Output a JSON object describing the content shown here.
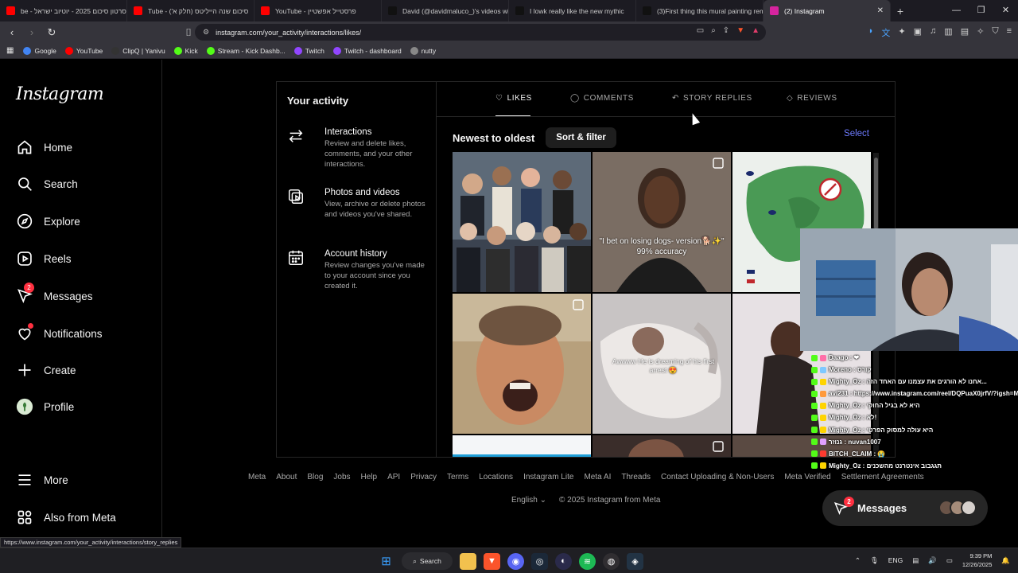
{
  "browser": {
    "tabs": [
      {
        "label": "be - סרטון סיכום 2025 - יוטיוב ישראל",
        "fav_color": "#ff0000"
      },
      {
        "label": "Tube - סיכום שנה הייליטס (חלק א')",
        "fav_color": "#ff0000"
      },
      {
        "label": "YouTube - פרסטייל אפשטיין",
        "fav_color": "#ff0000"
      },
      {
        "label": "David (@davidmaluco_)'s videos with",
        "fav_color": "#111111"
      },
      {
        "label": "I lowk really like the new mythic",
        "fav_color": "#111111"
      },
      {
        "label": "(3)First thing this mural painting rem",
        "fav_color": "#111111"
      },
      {
        "label": "(2) Instagram",
        "fav_color": "#d6249f"
      }
    ],
    "new_tab": "+",
    "url": "instagram.com/your_activity/interactions/likes/",
    "bookmarks": [
      {
        "label": "Google",
        "color": "#4285f4"
      },
      {
        "label": "YouTube",
        "color": "#ff0000"
      },
      {
        "label": "ClipQ | Yanivu",
        "color": "#333333"
      },
      {
        "label": "Kick",
        "color": "#53fc18"
      },
      {
        "label": "Stream - Kick Dashb...",
        "color": "#53fc18"
      },
      {
        "label": "Twitch",
        "color": "#9146ff"
      },
      {
        "label": "Twitch - dashboard",
        "color": "#9146ff"
      },
      {
        "label": "nutty",
        "color": "#888888"
      }
    ],
    "status_url": "https://www.instagram.com/your_activity/interactions/story_replies"
  },
  "instagram": {
    "logo": "Instagram",
    "nav": [
      {
        "label": "Home",
        "icon": "home-icon"
      },
      {
        "label": "Search",
        "icon": "search-icon"
      },
      {
        "label": "Explore",
        "icon": "explore-icon"
      },
      {
        "label": "Reels",
        "icon": "reels-icon"
      },
      {
        "label": "Messages",
        "icon": "messages-icon",
        "badge": "2"
      },
      {
        "label": "Notifications",
        "icon": "heart-icon"
      },
      {
        "label": "Create",
        "icon": "plus-icon"
      },
      {
        "label": "Profile",
        "icon": "avatar"
      }
    ],
    "more": "More",
    "also_from_meta": "Also from Meta",
    "activity": {
      "title": "Your activity",
      "menu": [
        {
          "title": "Interactions",
          "desc": "Review and delete likes, comments, and your other interactions."
        },
        {
          "title": "Photos and videos",
          "desc": "View, archive or delete photos and videos you've shared."
        },
        {
          "title": "Account history",
          "desc": "Review changes you've made to your account since you created it."
        }
      ]
    },
    "tabs": [
      "LIKES",
      "COMMENTS",
      "STORY REPLIES",
      "REVIEWS"
    ],
    "sort_label": "Newest to oldest",
    "sort_button": "Sort & filter",
    "select": "Select",
    "grid_captions": {
      "c2": "\"I bet on losing dogs- version🐕✨\"\n99% accuracy",
      "c5": "Awwww He is dreaming of his first arrest 😍"
    },
    "footer_links": [
      "Meta",
      "About",
      "Blog",
      "Jobs",
      "Help",
      "API",
      "Privacy",
      "Terms",
      "Locations",
      "Instagram Lite",
      "Meta AI",
      "Threads",
      "Contact Uploading & Non-Users",
      "Meta Verified",
      "Settlement Agreements"
    ],
    "language": "English",
    "copyright": "© 2025 Instagram from Meta",
    "messages_bar": "Messages",
    "messages_badge": "2"
  },
  "chat": [
    {
      "text": "Mighty_Oz : תגגבוב אינטרנט מהשכנים",
      "color": "#ffd400"
    },
    {
      "text": "BITCH_CLAIM : 😭",
      "color": "#ff3b30"
    },
    {
      "text": "גנוזר : nuvan1007",
      "color": "#e0a0ff"
    },
    {
      "text": "Mighty_Oz : היא עולה למסוק הפרטי",
      "color": "#ffd400"
    },
    {
      "text": "Mighty_Oz : לא!",
      "color": "#ffd400"
    },
    {
      "text": "Mighty_Oz : היא לא בגיל החוקי",
      "color": "#ffd400"
    },
    {
      "text": "avi231 : https://www.instagram.com/reel/DQPuaX0jrfV/?igsh=M",
      "color": "#ff9a3c"
    },
    {
      "text": "Mighty_Oz : אחנו לא הורגים את עצמנו עם האחד הזה...",
      "color": "#ffd400"
    },
    {
      "text": "Moreno : קורס",
      "color": "#7ec8ff"
    },
    {
      "text": "Daago : ❤",
      "color": "#ff6fa8"
    }
  ],
  "taskbar": {
    "search": "Search",
    "lang": "ENG",
    "time": "9:39 PM",
    "date": "12/26/2025"
  }
}
